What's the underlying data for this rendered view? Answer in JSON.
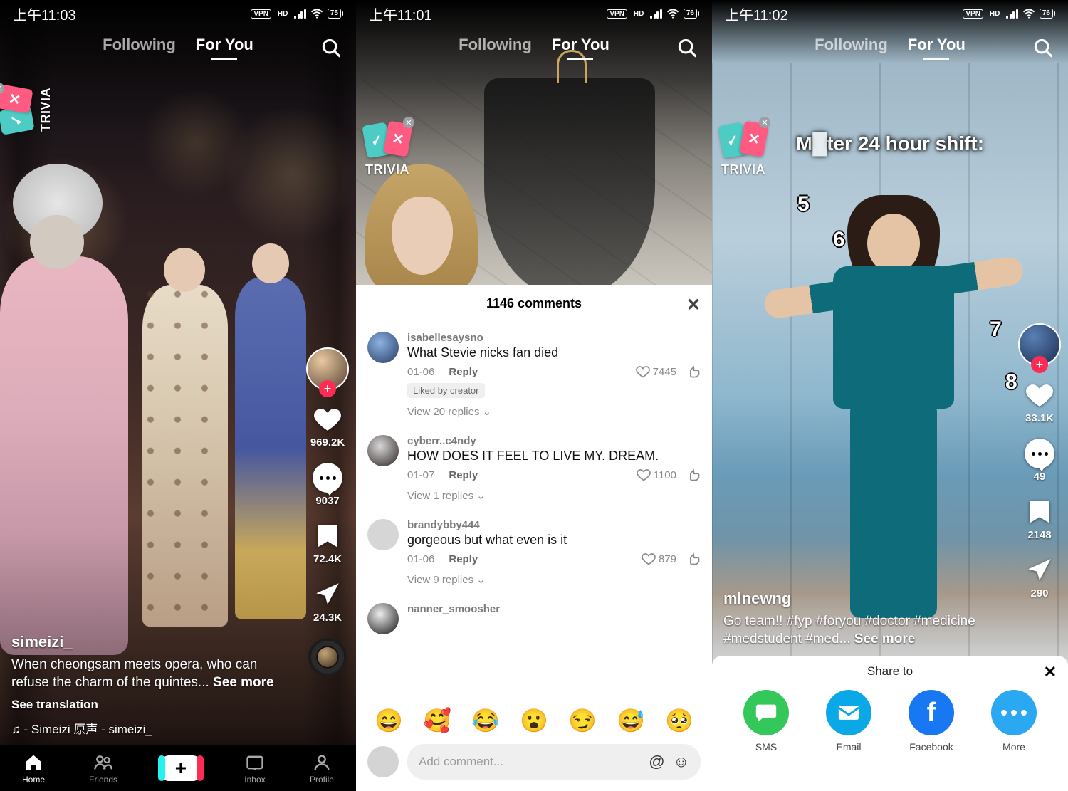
{
  "screen1": {
    "status": {
      "time": "上午11:03",
      "vpn": "VPN",
      "hd": "HD",
      "battery": "75"
    },
    "tabs": {
      "following": "Following",
      "foryou": "For You"
    },
    "trivia": "TRIVIA",
    "sidebar": {
      "likes": "969.2K",
      "comments": "9037",
      "bookmarks": "72.4K",
      "shares": "24.3K"
    },
    "info": {
      "username": "simeizi_",
      "caption": "When cheongsam meets opera, who can refuse the charm of the quintes...",
      "seemore": "See more",
      "seetranslation": "See translation",
      "music": "♫ - Simeizi  原声 - simeizi_"
    },
    "nav": {
      "home": "Home",
      "friends": "Friends",
      "inbox": "Inbox",
      "profile": "Profile"
    }
  },
  "screen2": {
    "status": {
      "time": "上午11:01",
      "vpn": "VPN",
      "hd": "HD",
      "battery": "76"
    },
    "tabs": {
      "following": "Following",
      "foryou": "For You"
    },
    "trivia": "TRIVIA",
    "commentsHeader": "1146 comments",
    "comments": [
      {
        "name": "isabellesaysno",
        "text": "What Stevie nicks fan died",
        "date": "01-06",
        "reply": "Reply",
        "likes": "7445",
        "liked": "Liked by creator",
        "viewreplies": "View 20 replies"
      },
      {
        "name": "cyberr..c4ndy",
        "text": "HOW DOES IT FEEL TO LIVE MY. DREAM.",
        "date": "01-07",
        "reply": "Reply",
        "likes": "1100",
        "viewreplies": "View 1 replies"
      },
      {
        "name": "brandybby444",
        "text": "gorgeous but what even is it",
        "date": "01-06",
        "reply": "Reply",
        "likes": "879",
        "viewreplies": "View 9 replies"
      },
      {
        "name": "nanner_smoosher",
        "text": ""
      }
    ],
    "emojis": [
      "😄",
      "🥰",
      "😂",
      "😮",
      "😏",
      "😅",
      "🥺"
    ],
    "addComment": "Add comment..."
  },
  "screen3": {
    "status": {
      "time": "上午11:02",
      "vpn": "VPN",
      "hd": "HD",
      "battery": "76"
    },
    "tabs": {
      "following": "Following",
      "foryou": "For You"
    },
    "trivia": "TRIVIA",
    "overlayLeft": "M",
    "overlaySuffix": "ter 24 hour shift:",
    "countNums": [
      "5",
      "6",
      "7",
      "8"
    ],
    "sidebar": {
      "likes": "33.1K",
      "comments": "49",
      "bookmarks": "2148",
      "shares": "290"
    },
    "info": {
      "username": "mlnewng",
      "caption": "Go team!! #fyp #foryou #doctor #medicine #medstudent #med...",
      "seemore": "See more"
    },
    "share": {
      "title": "Share to",
      "items": [
        {
          "label": "SMS",
          "color": "#34c759"
        },
        {
          "label": "Email",
          "color": "#0aa8e6"
        },
        {
          "label": "Facebook",
          "color": "#1877f2"
        },
        {
          "label": "More",
          "color": "#2aa8f2"
        }
      ]
    }
  }
}
